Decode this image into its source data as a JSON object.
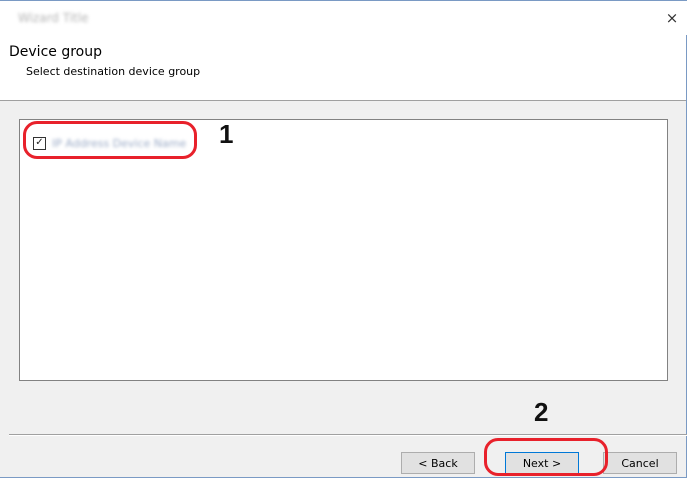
{
  "window": {
    "title": "Wizard Title",
    "close_glyph": "×"
  },
  "header": {
    "title": "Device group",
    "subtitle": "Select destination device group"
  },
  "device_list": {
    "items": [
      {
        "label": "IP Address Device Name",
        "checked": true
      }
    ]
  },
  "callouts": {
    "one": "1",
    "two": "2"
  },
  "buttons": {
    "back": "< Back",
    "next": "Next >",
    "cancel": "Cancel"
  },
  "colors": {
    "callout": "#e8212b",
    "accent": "#0078d7"
  },
  "icons": {
    "check": "☑"
  }
}
